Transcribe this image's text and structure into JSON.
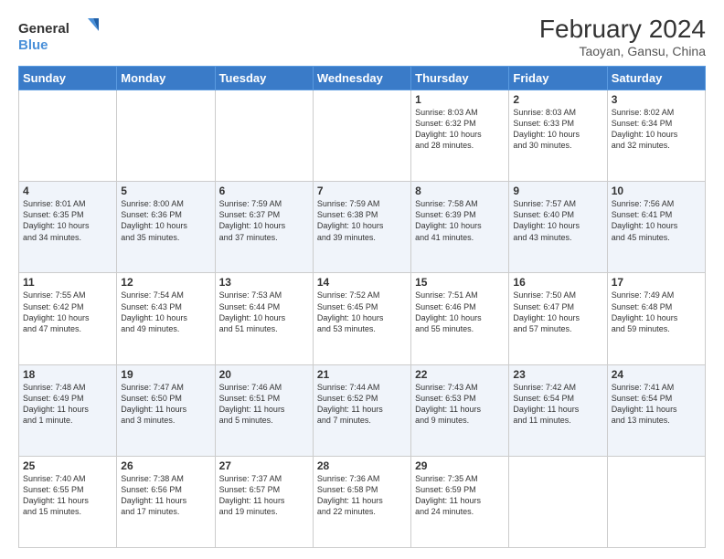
{
  "header": {
    "logo_line1": "General",
    "logo_line2": "Blue",
    "month_year": "February 2024",
    "location": "Taoyan, Gansu, China"
  },
  "weekdays": [
    "Sunday",
    "Monday",
    "Tuesday",
    "Wednesday",
    "Thursday",
    "Friday",
    "Saturday"
  ],
  "weeks": [
    [
      {
        "day": "",
        "info": ""
      },
      {
        "day": "",
        "info": ""
      },
      {
        "day": "",
        "info": ""
      },
      {
        "day": "",
        "info": ""
      },
      {
        "day": "1",
        "info": "Sunrise: 8:03 AM\nSunset: 6:32 PM\nDaylight: 10 hours\nand 28 minutes."
      },
      {
        "day": "2",
        "info": "Sunrise: 8:03 AM\nSunset: 6:33 PM\nDaylight: 10 hours\nand 30 minutes."
      },
      {
        "day": "3",
        "info": "Sunrise: 8:02 AM\nSunset: 6:34 PM\nDaylight: 10 hours\nand 32 minutes."
      }
    ],
    [
      {
        "day": "4",
        "info": "Sunrise: 8:01 AM\nSunset: 6:35 PM\nDaylight: 10 hours\nand 34 minutes."
      },
      {
        "day": "5",
        "info": "Sunrise: 8:00 AM\nSunset: 6:36 PM\nDaylight: 10 hours\nand 35 minutes."
      },
      {
        "day": "6",
        "info": "Sunrise: 7:59 AM\nSunset: 6:37 PM\nDaylight: 10 hours\nand 37 minutes."
      },
      {
        "day": "7",
        "info": "Sunrise: 7:59 AM\nSunset: 6:38 PM\nDaylight: 10 hours\nand 39 minutes."
      },
      {
        "day": "8",
        "info": "Sunrise: 7:58 AM\nSunset: 6:39 PM\nDaylight: 10 hours\nand 41 minutes."
      },
      {
        "day": "9",
        "info": "Sunrise: 7:57 AM\nSunset: 6:40 PM\nDaylight: 10 hours\nand 43 minutes."
      },
      {
        "day": "10",
        "info": "Sunrise: 7:56 AM\nSunset: 6:41 PM\nDaylight: 10 hours\nand 45 minutes."
      }
    ],
    [
      {
        "day": "11",
        "info": "Sunrise: 7:55 AM\nSunset: 6:42 PM\nDaylight: 10 hours\nand 47 minutes."
      },
      {
        "day": "12",
        "info": "Sunrise: 7:54 AM\nSunset: 6:43 PM\nDaylight: 10 hours\nand 49 minutes."
      },
      {
        "day": "13",
        "info": "Sunrise: 7:53 AM\nSunset: 6:44 PM\nDaylight: 10 hours\nand 51 minutes."
      },
      {
        "day": "14",
        "info": "Sunrise: 7:52 AM\nSunset: 6:45 PM\nDaylight: 10 hours\nand 53 minutes."
      },
      {
        "day": "15",
        "info": "Sunrise: 7:51 AM\nSunset: 6:46 PM\nDaylight: 10 hours\nand 55 minutes."
      },
      {
        "day": "16",
        "info": "Sunrise: 7:50 AM\nSunset: 6:47 PM\nDaylight: 10 hours\nand 57 minutes."
      },
      {
        "day": "17",
        "info": "Sunrise: 7:49 AM\nSunset: 6:48 PM\nDaylight: 10 hours\nand 59 minutes."
      }
    ],
    [
      {
        "day": "18",
        "info": "Sunrise: 7:48 AM\nSunset: 6:49 PM\nDaylight: 11 hours\nand 1 minute."
      },
      {
        "day": "19",
        "info": "Sunrise: 7:47 AM\nSunset: 6:50 PM\nDaylight: 11 hours\nand 3 minutes."
      },
      {
        "day": "20",
        "info": "Sunrise: 7:46 AM\nSunset: 6:51 PM\nDaylight: 11 hours\nand 5 minutes."
      },
      {
        "day": "21",
        "info": "Sunrise: 7:44 AM\nSunset: 6:52 PM\nDaylight: 11 hours\nand 7 minutes."
      },
      {
        "day": "22",
        "info": "Sunrise: 7:43 AM\nSunset: 6:53 PM\nDaylight: 11 hours\nand 9 minutes."
      },
      {
        "day": "23",
        "info": "Sunrise: 7:42 AM\nSunset: 6:54 PM\nDaylight: 11 hours\nand 11 minutes."
      },
      {
        "day": "24",
        "info": "Sunrise: 7:41 AM\nSunset: 6:54 PM\nDaylight: 11 hours\nand 13 minutes."
      }
    ],
    [
      {
        "day": "25",
        "info": "Sunrise: 7:40 AM\nSunset: 6:55 PM\nDaylight: 11 hours\nand 15 minutes."
      },
      {
        "day": "26",
        "info": "Sunrise: 7:38 AM\nSunset: 6:56 PM\nDaylight: 11 hours\nand 17 minutes."
      },
      {
        "day": "27",
        "info": "Sunrise: 7:37 AM\nSunset: 6:57 PM\nDaylight: 11 hours\nand 19 minutes."
      },
      {
        "day": "28",
        "info": "Sunrise: 7:36 AM\nSunset: 6:58 PM\nDaylight: 11 hours\nand 22 minutes."
      },
      {
        "day": "29",
        "info": "Sunrise: 7:35 AM\nSunset: 6:59 PM\nDaylight: 11 hours\nand 24 minutes."
      },
      {
        "day": "",
        "info": ""
      },
      {
        "day": "",
        "info": ""
      }
    ]
  ]
}
